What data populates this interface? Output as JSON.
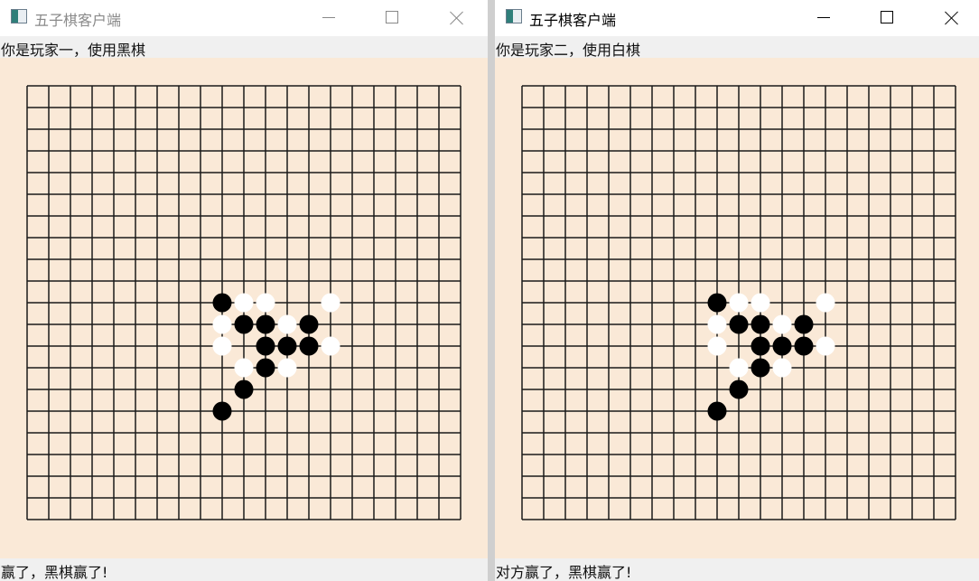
{
  "windows": [
    {
      "title": "五子棋客户端",
      "player_label": "你是玩家一，使用黑棋",
      "status_text": "赢了，黑棋赢了!",
      "active": false
    },
    {
      "title": "五子棋客户端",
      "player_label": "你是玩家二，使用白棋",
      "status_text": "对方赢了，黑棋赢了!",
      "active": true
    }
  ],
  "board": {
    "lines": 21,
    "line_color": "#1a1a1a",
    "background": "#fae9d7",
    "black_color": "#000000",
    "white_color": "#ffffff",
    "black_stones": [
      [
        9,
        10
      ],
      [
        10,
        11
      ],
      [
        11,
        11
      ],
      [
        13,
        11
      ],
      [
        11,
        12
      ],
      [
        12,
        12
      ],
      [
        13,
        12
      ],
      [
        11,
        13
      ],
      [
        10,
        14
      ],
      [
        9,
        15
      ]
    ],
    "white_stones": [
      [
        10,
        10
      ],
      [
        11,
        10
      ],
      [
        14,
        10
      ],
      [
        9,
        11
      ],
      [
        12,
        11
      ],
      [
        9,
        12
      ],
      [
        14,
        12
      ],
      [
        10,
        13
      ],
      [
        12,
        13
      ]
    ]
  }
}
